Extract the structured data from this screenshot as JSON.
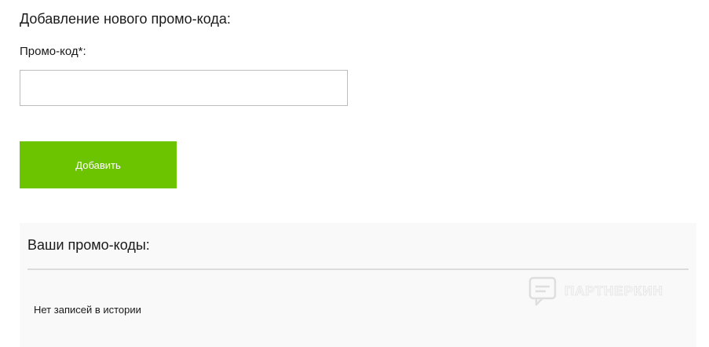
{
  "add_section": {
    "title": "Добавление нового промо-кода:",
    "field_label": "Промо-код*:",
    "input_value": "",
    "input_placeholder": "",
    "submit_label": "Добавить"
  },
  "codes_section": {
    "title": "Ваши промо-коды:",
    "empty_message": "Нет записей в истории",
    "watermark": "ПАРТНЕРКИН"
  },
  "colors": {
    "accent": "#6cc400",
    "panel_background": "#f9f9f9"
  }
}
